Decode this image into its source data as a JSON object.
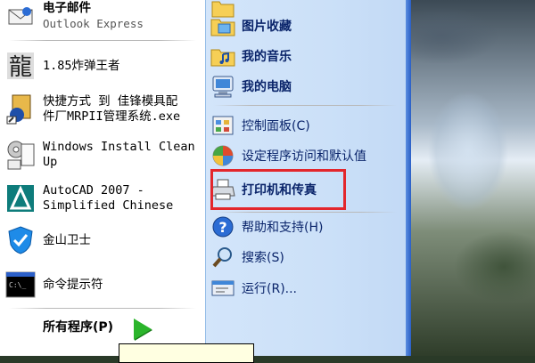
{
  "start_menu": {
    "left": {
      "email": {
        "title": "电子邮件",
        "subtitle": "Outlook Express"
      },
      "recent": [
        {
          "label": "1.85炸弹王者"
        },
        {
          "label_line1": "快捷方式 到 佳锋模具配",
          "label_line2": "件厂MRPII管理系统.exe"
        },
        {
          "label_line1": "Windows Install Clean",
          "label_line2": "Up"
        },
        {
          "label_line1": "AutoCAD 2007 -",
          "label_line2": "Simplified Chinese"
        },
        {
          "label": "金山卫士"
        },
        {
          "label": "命令提示符"
        }
      ],
      "all_programs": "所有程序(P)"
    },
    "right": {
      "items": [
        {
          "label": "图片收藏",
          "icon": "pictures-folder-icon"
        },
        {
          "label": "我的音乐",
          "icon": "music-folder-icon"
        },
        {
          "label": "我的电脑",
          "icon": "my-computer-icon"
        },
        {
          "label": "控制面板(C)",
          "icon": "control-panel-icon"
        },
        {
          "label": "设定程序访问和默认值",
          "icon": "program-access-icon"
        },
        {
          "label": "打印机和传真",
          "icon": "printer-icon"
        },
        {
          "label": "帮助和支持(H)",
          "icon": "help-icon"
        },
        {
          "label": "搜索(S)",
          "icon": "search-icon"
        },
        {
          "label": "运行(R)...",
          "icon": "run-icon"
        }
      ]
    }
  },
  "colors": {
    "menu_right_bg": "#cbe0f8",
    "highlight_border": "#e3262c",
    "arrow": "#2bb52b"
  }
}
